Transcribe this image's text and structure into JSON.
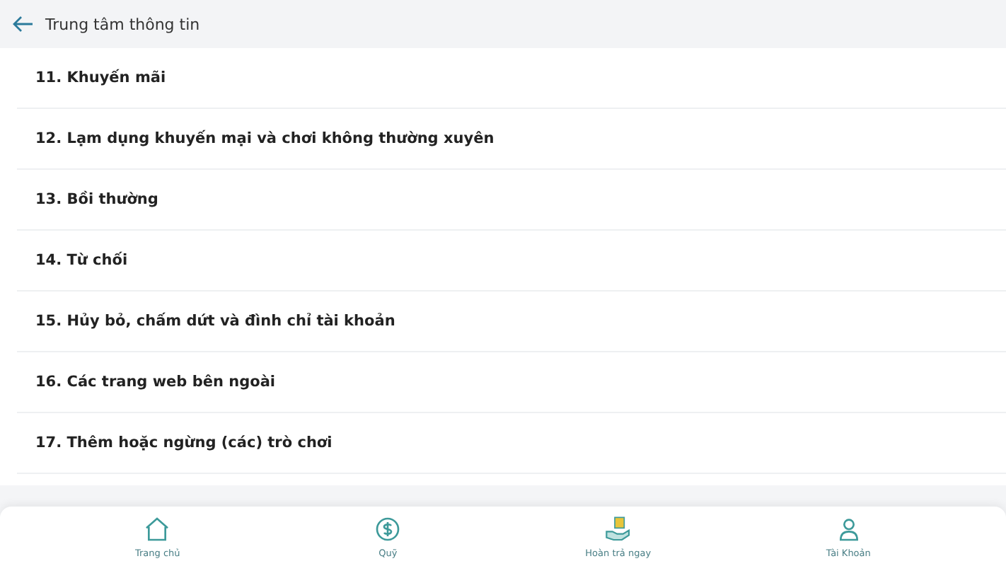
{
  "header": {
    "title": "Trung tâm thông tin"
  },
  "items": [
    "11. Khuyến mãi",
    "12. Lạm dụng khuyến mại và chơi không thường xuyên",
    "13. Bồi thường",
    "14. Từ chối",
    "15. Hủy bỏ, chấm dứt và đình chỉ tài khoản",
    "16. Các trang web bên ngoài",
    "17. Thêm hoặc ngừng (các) trò chơi"
  ],
  "nav": [
    {
      "label": "Trang chủ",
      "kind": "home"
    },
    {
      "label": "Quỹ",
      "kind": "fund"
    },
    {
      "label": "Hoàn trả ngay",
      "kind": "refund"
    },
    {
      "label": "Tài Khoản",
      "kind": "account"
    }
  ]
}
